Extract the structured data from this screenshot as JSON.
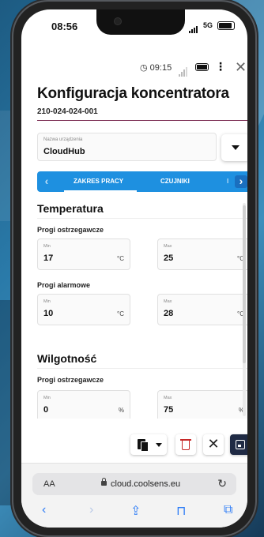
{
  "status_bar": {
    "time": "08:56",
    "network": "5G"
  },
  "app_header": {
    "clock": "09:15"
  },
  "page_title": "Konfiguracja koncentratora",
  "serial_number": "210-024-024-001",
  "device_name": {
    "label": "Nazwa urządzenia",
    "value": "CloudHub"
  },
  "tabs": [
    {
      "label": "ZAKRES PRACY",
      "active": true
    },
    {
      "label": "CZUJNIKI",
      "active": false
    },
    {
      "label": "I",
      "active": false
    }
  ],
  "sections": [
    {
      "title": "Temperatura",
      "groups": [
        {
          "title": "Progi ostrzegawcze",
          "min": {
            "label": "Min",
            "value": "17",
            "unit": "°C"
          },
          "max": {
            "label": "Max",
            "value": "25",
            "unit": "°C"
          }
        },
        {
          "title": "Progi alarmowe",
          "min": {
            "label": "Min",
            "value": "10",
            "unit": "°C"
          },
          "max": {
            "label": "Max",
            "value": "28",
            "unit": "°C"
          }
        }
      ]
    },
    {
      "title": "Wilgotność",
      "groups": [
        {
          "title": "Progi ostrzegawcze",
          "min": {
            "label": "Min",
            "value": "0",
            "unit": "%"
          },
          "max": {
            "label": "Max",
            "value": "75",
            "unit": "%"
          }
        }
      ]
    }
  ],
  "browser": {
    "text_size_label": "AA",
    "host": "cloud.coolsens.eu"
  },
  "colors": {
    "accent_blue": "#1e90e0",
    "save_dark": "#1f2a44",
    "delete_red": "#c62828",
    "underline": "#7a2b52"
  }
}
